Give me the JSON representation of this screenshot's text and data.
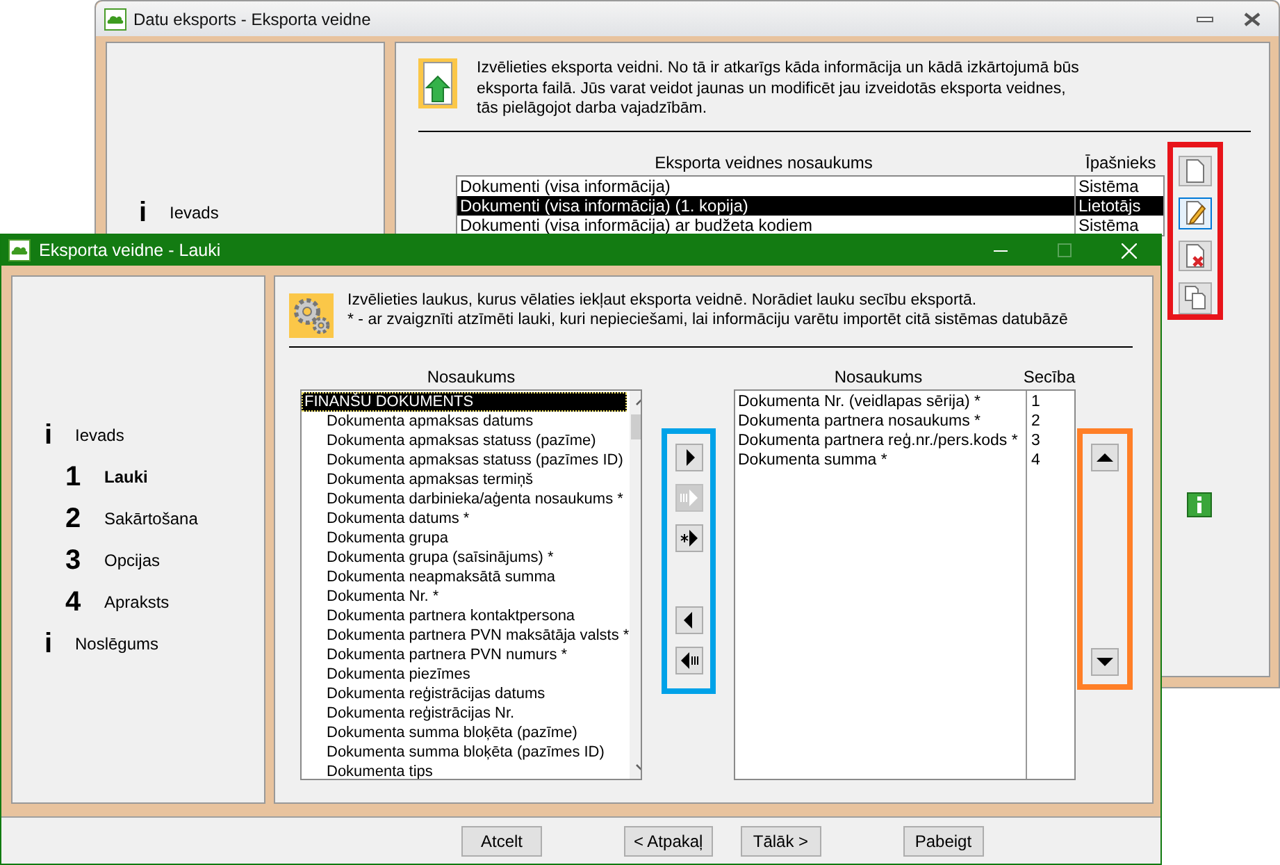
{
  "back_window": {
    "title": "Datu eksports - Eksporta veidne",
    "steps": [
      {
        "marker": "i",
        "label": "Ievads"
      }
    ],
    "intro": "Izvēlieties eksporta veidni. No tā ir atkarīgs kāda informācija un kādā izkārtojumā būs eksporta failā. Jūs varat veidot jaunas un modificēt jau izveidotās eksporta veidnes, tās pielāgojot darba vajadzībām.",
    "table": {
      "columns": [
        "Eksporta veidnes nosaukums",
        "Īpašnieks"
      ],
      "rows": [
        {
          "cells": [
            "Dokumenti (visa informācija)",
            "Sistēma"
          ],
          "selected": false
        },
        {
          "cells": [
            "Dokumenti (visa informācija) (1. kopija)",
            "Lietotājs"
          ],
          "selected": true
        },
        {
          "cells": [
            "Dokumenti (visa informācija) ar budžeta kodiem",
            "Sistēma"
          ],
          "selected": false
        }
      ]
    },
    "tool_buttons": [
      {
        "kind": "new",
        "selected": false
      },
      {
        "kind": "edit",
        "selected": true
      },
      {
        "kind": "delete",
        "selected": false
      },
      {
        "kind": "copy",
        "selected": false
      }
    ]
  },
  "front_window": {
    "title": "Eksporta veidne - Lauki",
    "steps": [
      {
        "kind": "info",
        "marker": "i",
        "label": "Ievads",
        "selected": false
      },
      {
        "kind": "number",
        "marker": "1",
        "label": "Lauki",
        "selected": true
      },
      {
        "kind": "number",
        "marker": "2",
        "label": "Sakārtošana",
        "selected": false
      },
      {
        "kind": "number",
        "marker": "3",
        "label": "Opcijas",
        "selected": false
      },
      {
        "kind": "number",
        "marker": "4",
        "label": "Apraksts",
        "selected": false
      },
      {
        "kind": "info",
        "marker": "i",
        "label": "Noslēgums",
        "selected": false
      }
    ],
    "intro": [
      "Izvēlieties laukus, kurus vēlaties iekļaut eksporta veidnē. Norādiet lauku secību eksportā.",
      "* - ar zvaigznīti atzīmēti lauki, kuri nepieciešami, lai informāciju varētu importēt citā sistēmas datubāzē"
    ],
    "available": {
      "column": "Nosaukums",
      "items": [
        {
          "label": "FINANŠU DOKUMENTS",
          "selected": true,
          "children": [
            {
              "label": "Dokumenta apmaksas datums",
              "selected": false
            },
            {
              "label": "Dokumenta apmaksas statuss (pazīme)",
              "selected": false
            },
            {
              "label": "Dokumenta apmaksas statuss (pazīmes ID)",
              "selected": false
            },
            {
              "label": "Dokumenta apmaksas termiņš",
              "selected": false
            },
            {
              "label": "Dokumenta darbinieka/aģenta nosaukums *",
              "selected": false
            },
            {
              "label": "Dokumenta datums *",
              "selected": false
            },
            {
              "label": "Dokumenta grupa",
              "selected": false
            },
            {
              "label": "Dokumenta grupa (saīsinājums) *",
              "selected": false
            },
            {
              "label": "Dokumenta neapmaksātā summa",
              "selected": false
            },
            {
              "label": "Dokumenta Nr. *",
              "selected": false
            },
            {
              "label": "Dokumenta partnera kontaktpersona",
              "selected": false
            },
            {
              "label": "Dokumenta partnera PVN maksātāja valsts *",
              "selected": false
            },
            {
              "label": "Dokumenta partnera PVN numurs *",
              "selected": false
            },
            {
              "label": "Dokumenta piezīmes",
              "selected": false
            },
            {
              "label": "Dokumenta reģistrācijas datums",
              "selected": false
            },
            {
              "label": "Dokumenta reģistrācijas Nr.",
              "selected": false
            },
            {
              "label": "Dokumenta summa bloķēta (pazīme)",
              "selected": false
            },
            {
              "label": "Dokumenta summa bloķēta (pazīmes ID)",
              "selected": false
            },
            {
              "label": "Dokumenta tips",
              "selected": false
            }
          ]
        }
      ]
    },
    "transfer_buttons": [
      {
        "kind": "add",
        "disabled": false
      },
      {
        "kind": "add-all",
        "disabled": true
      },
      {
        "kind": "add-required",
        "disabled": false
      },
      {
        "kind": "remove",
        "disabled": false
      },
      {
        "kind": "remove-all",
        "disabled": false
      }
    ],
    "selected_fields": {
      "columns": [
        "Nosaukums",
        "Secība"
      ],
      "rows": [
        {
          "cells": [
            "Dokumenta Nr. (veidlapas sērija) *",
            "1"
          ]
        },
        {
          "cells": [
            "Dokumenta partnera nosaukums *",
            "2"
          ]
        },
        {
          "cells": [
            "Dokumenta partnera reģ.nr./pers.kods *",
            "3"
          ]
        },
        {
          "cells": [
            "Dokumenta summa *",
            "4"
          ]
        }
      ]
    },
    "order_buttons": [
      {
        "kind": "up"
      },
      {
        "kind": "down"
      }
    ],
    "buttons": [
      "Atcelt",
      "< Atpakaļ",
      "Tālāk >",
      "Pabeigt"
    ]
  }
}
